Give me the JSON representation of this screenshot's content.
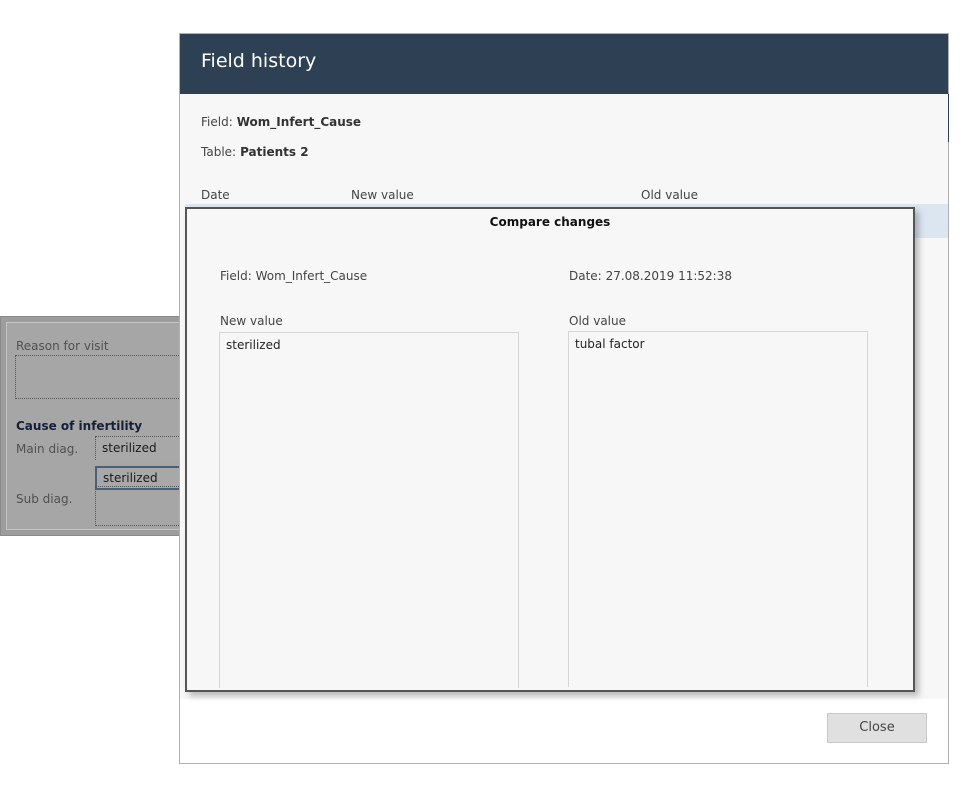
{
  "background_form": {
    "reason_label": "Reason for visit",
    "section_heading": "Cause of infertility",
    "main_diag_label": "Main diag.",
    "main_diag_value": "sterilized",
    "main_diag_value_selected": "sterilized",
    "sub_diag_label": "Sub diag."
  },
  "dialog": {
    "title": "Field history",
    "field_label": "Field:",
    "field_value": "Wom_Infert_Cause",
    "table_label": "Table:",
    "table_value": "Patients 2",
    "columns": [
      "Date",
      "New value",
      "Old value"
    ],
    "close_label": "Close"
  },
  "compare": {
    "title": "Compare changes",
    "field_label": "Field:",
    "field_value": "Wom_Infert_Cause",
    "date_label": "Date:",
    "date_value": "27.08.2019 11:52:38",
    "new_value_label": "New value",
    "new_value": "sterilized",
    "old_value_label": "Old value",
    "old_value": "tubal factor"
  }
}
